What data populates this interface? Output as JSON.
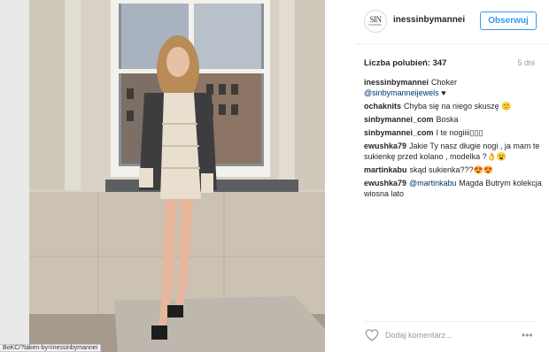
{
  "post": {
    "username": "inessinbymannei",
    "follow_label": "Obserwuj",
    "avatar_text": "SIN",
    "avatar_subtext": "BYMANNEI",
    "likes_label": "Liczba polubień: 347",
    "time_ago": "5 dni",
    "comments": [
      {
        "user": "inessinbymannei",
        "text": "Choker",
        "link": "@sinbymanneijewels",
        "tail": " ♥"
      },
      {
        "user": "ochaknits",
        "text": "Chyba się na niego skuszę 🙂"
      },
      {
        "user": "sinbymannei_com",
        "text": "Boska"
      },
      {
        "user": "sinbymannei_com",
        "text": "I te nogiiii▯▯▯"
      },
      {
        "user": "ewushka79",
        "text": "Jakie Ty nasz długie nogi , ja mam te sukienkę przed kolano , modelka ?👌😮"
      },
      {
        "user": "martinkabu",
        "text": "skąd sukienka???😍😍"
      },
      {
        "user": "ewushka79",
        "link": "@martinkabu",
        "text": " Magda Butrym kolekcja wiosna lato"
      }
    ],
    "add_comment_placeholder": "Dodaj komentarz...",
    "more_label": "•••"
  },
  "status_url": "BoKC/?taken-by=inessinbymannei",
  "colors": {
    "accent": "#3897f0",
    "link": "#003569",
    "muted": "#999999"
  }
}
